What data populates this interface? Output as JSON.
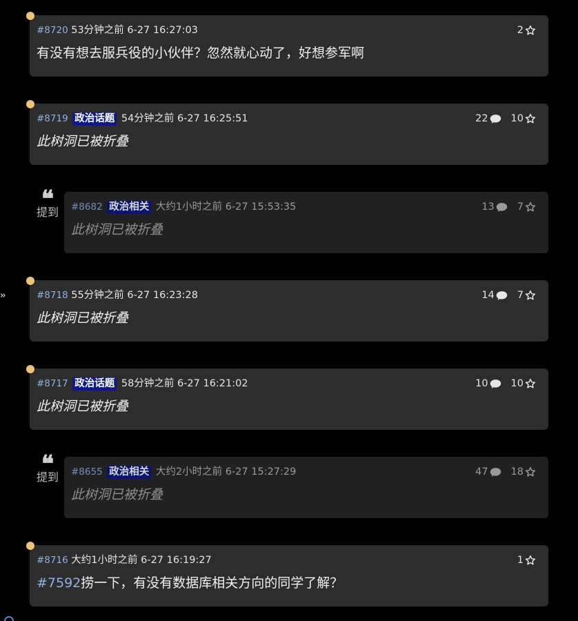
{
  "posts": [
    {
      "id": "#8720",
      "time": "53分钟之前 6-27 16:27:03",
      "likes": "2",
      "content": "有没有想去服兵役的小伙伴？忽然就心动了，好想参军啊"
    },
    {
      "id": "#8719",
      "tag": "政治话题",
      "time": "54分钟之前 6-27 16:25:51",
      "replies": "22",
      "likes": "10",
      "content": "此树洞已被折叠"
    },
    {
      "id": "#8682",
      "tag": "政治相关",
      "time": "大约1小时之前 6-27 15:53:35",
      "replies": "13",
      "likes": "7",
      "content": "此树洞已被折叠",
      "mention_label": "提到"
    },
    {
      "id": "#8718",
      "time": "55分钟之前 6-27 16:23:28",
      "replies": "14",
      "likes": "7",
      "content": "此树洞已被折叠"
    },
    {
      "id": "#8717",
      "tag": "政治话题",
      "time": "58分钟之前 6-27 16:21:02",
      "replies": "10",
      "likes": "10",
      "content": "此树洞已被折叠"
    },
    {
      "id": "#8655",
      "tag": "政治相关",
      "time": "大约2小时之前 6-27 15:27:29",
      "replies": "47",
      "likes": "18",
      "content": "此树洞已被折叠",
      "mention_label": "提到"
    },
    {
      "id": "#8716",
      "time": "大约1小时之前 6-27 16:19:27",
      "likes": "1",
      "content_link": "#7592",
      "content": "捞一下，有没有数据库相关方向的同学了解？"
    }
  ],
  "mention_quote": "❝",
  "colors": {
    "background": "#000000",
    "card": "#2d2d2d",
    "ref_card": "#212121",
    "dot": "#f2c179",
    "id_link": "#8eb2e6",
    "tag_bg": "#0c188c"
  },
  "icons": {
    "reply": "comment-bubble-icon",
    "like": "star-outline-icon",
    "marker": "orange-dot-icon"
  }
}
